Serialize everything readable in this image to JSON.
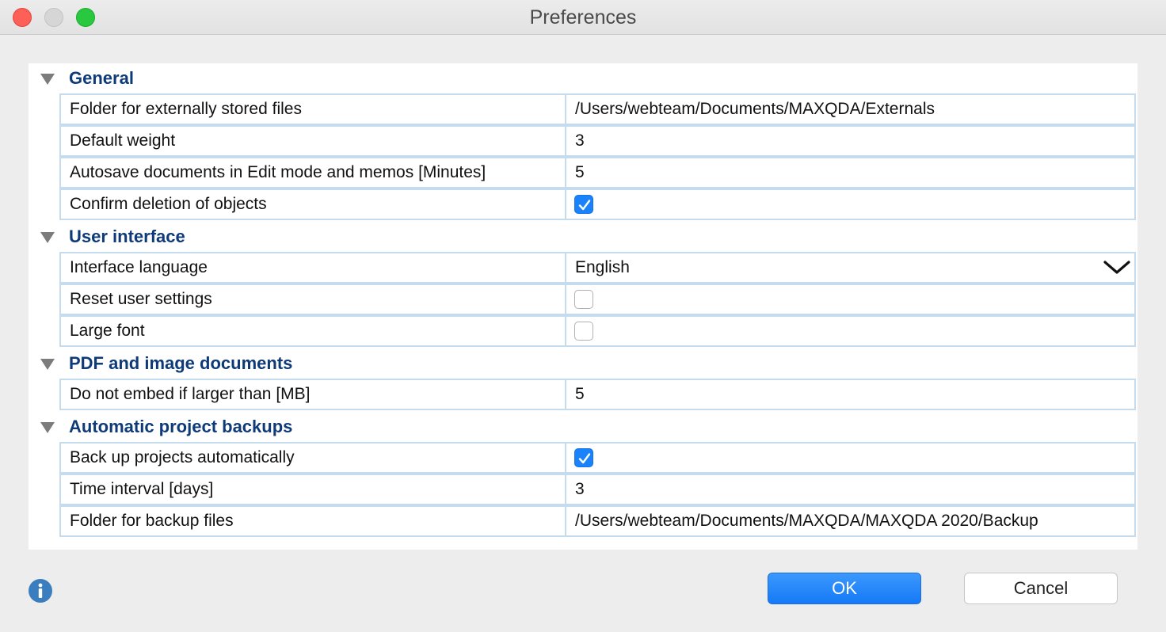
{
  "window": {
    "title": "Preferences"
  },
  "sections": [
    {
      "title": "General",
      "rows": [
        {
          "label": "Folder for externally stored files",
          "value": "/Users/webteam/Documents/MAXQDA/Externals"
        },
        {
          "label": "Default weight",
          "value": "3"
        },
        {
          "label": "Autosave documents in Edit mode and memos [Minutes]",
          "value": "5"
        },
        {
          "label": "Confirm deletion of objects",
          "checked": true
        }
      ]
    },
    {
      "title": "User interface",
      "rows": [
        {
          "label": "Interface language",
          "value": "English"
        },
        {
          "label": "Reset user settings",
          "checked": false
        },
        {
          "label": "Large font",
          "checked": false
        }
      ]
    },
    {
      "title": "PDF and image documents",
      "rows": [
        {
          "label": "Do not embed if larger than [MB]",
          "value": "5"
        }
      ]
    },
    {
      "title": "Automatic project backups",
      "rows": [
        {
          "label": "Back up projects automatically",
          "checked": true
        },
        {
          "label": "Time interval [days]",
          "value": "3"
        },
        {
          "label": "Folder for backup files",
          "value": "/Users/webteam/Documents/MAXQDA/MAXQDA 2020/Backup"
        }
      ]
    }
  ],
  "buttons": {
    "ok_label": "OK",
    "cancel_label": "Cancel"
  },
  "icons": {
    "info": "info-icon",
    "section_toggle": "triangle-down-icon",
    "dropdown": "chevron-down-icon"
  },
  "colors": {
    "accent": "#1a82fb",
    "section_title": "#0f3a78",
    "grid_border": "#c5dcee"
  }
}
